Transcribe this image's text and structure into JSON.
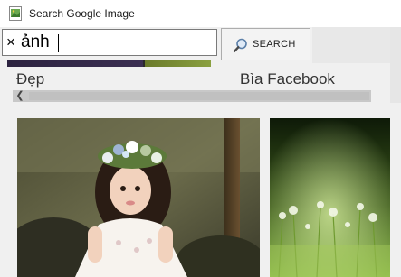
{
  "window": {
    "title": "Search Google Image"
  },
  "search": {
    "clear_glyph": "×",
    "query": "ảnh",
    "button_label": "SEARCH"
  },
  "categories": [
    "Đẹp",
    "Bìa Facebook"
  ],
  "scroll": {
    "left_arrow": "❮"
  },
  "icons": {
    "app": "image-file-icon",
    "search": "magnifier-icon"
  },
  "colors": {
    "accent": "#2f72c4",
    "scrollbar": "#c8c8c8"
  }
}
